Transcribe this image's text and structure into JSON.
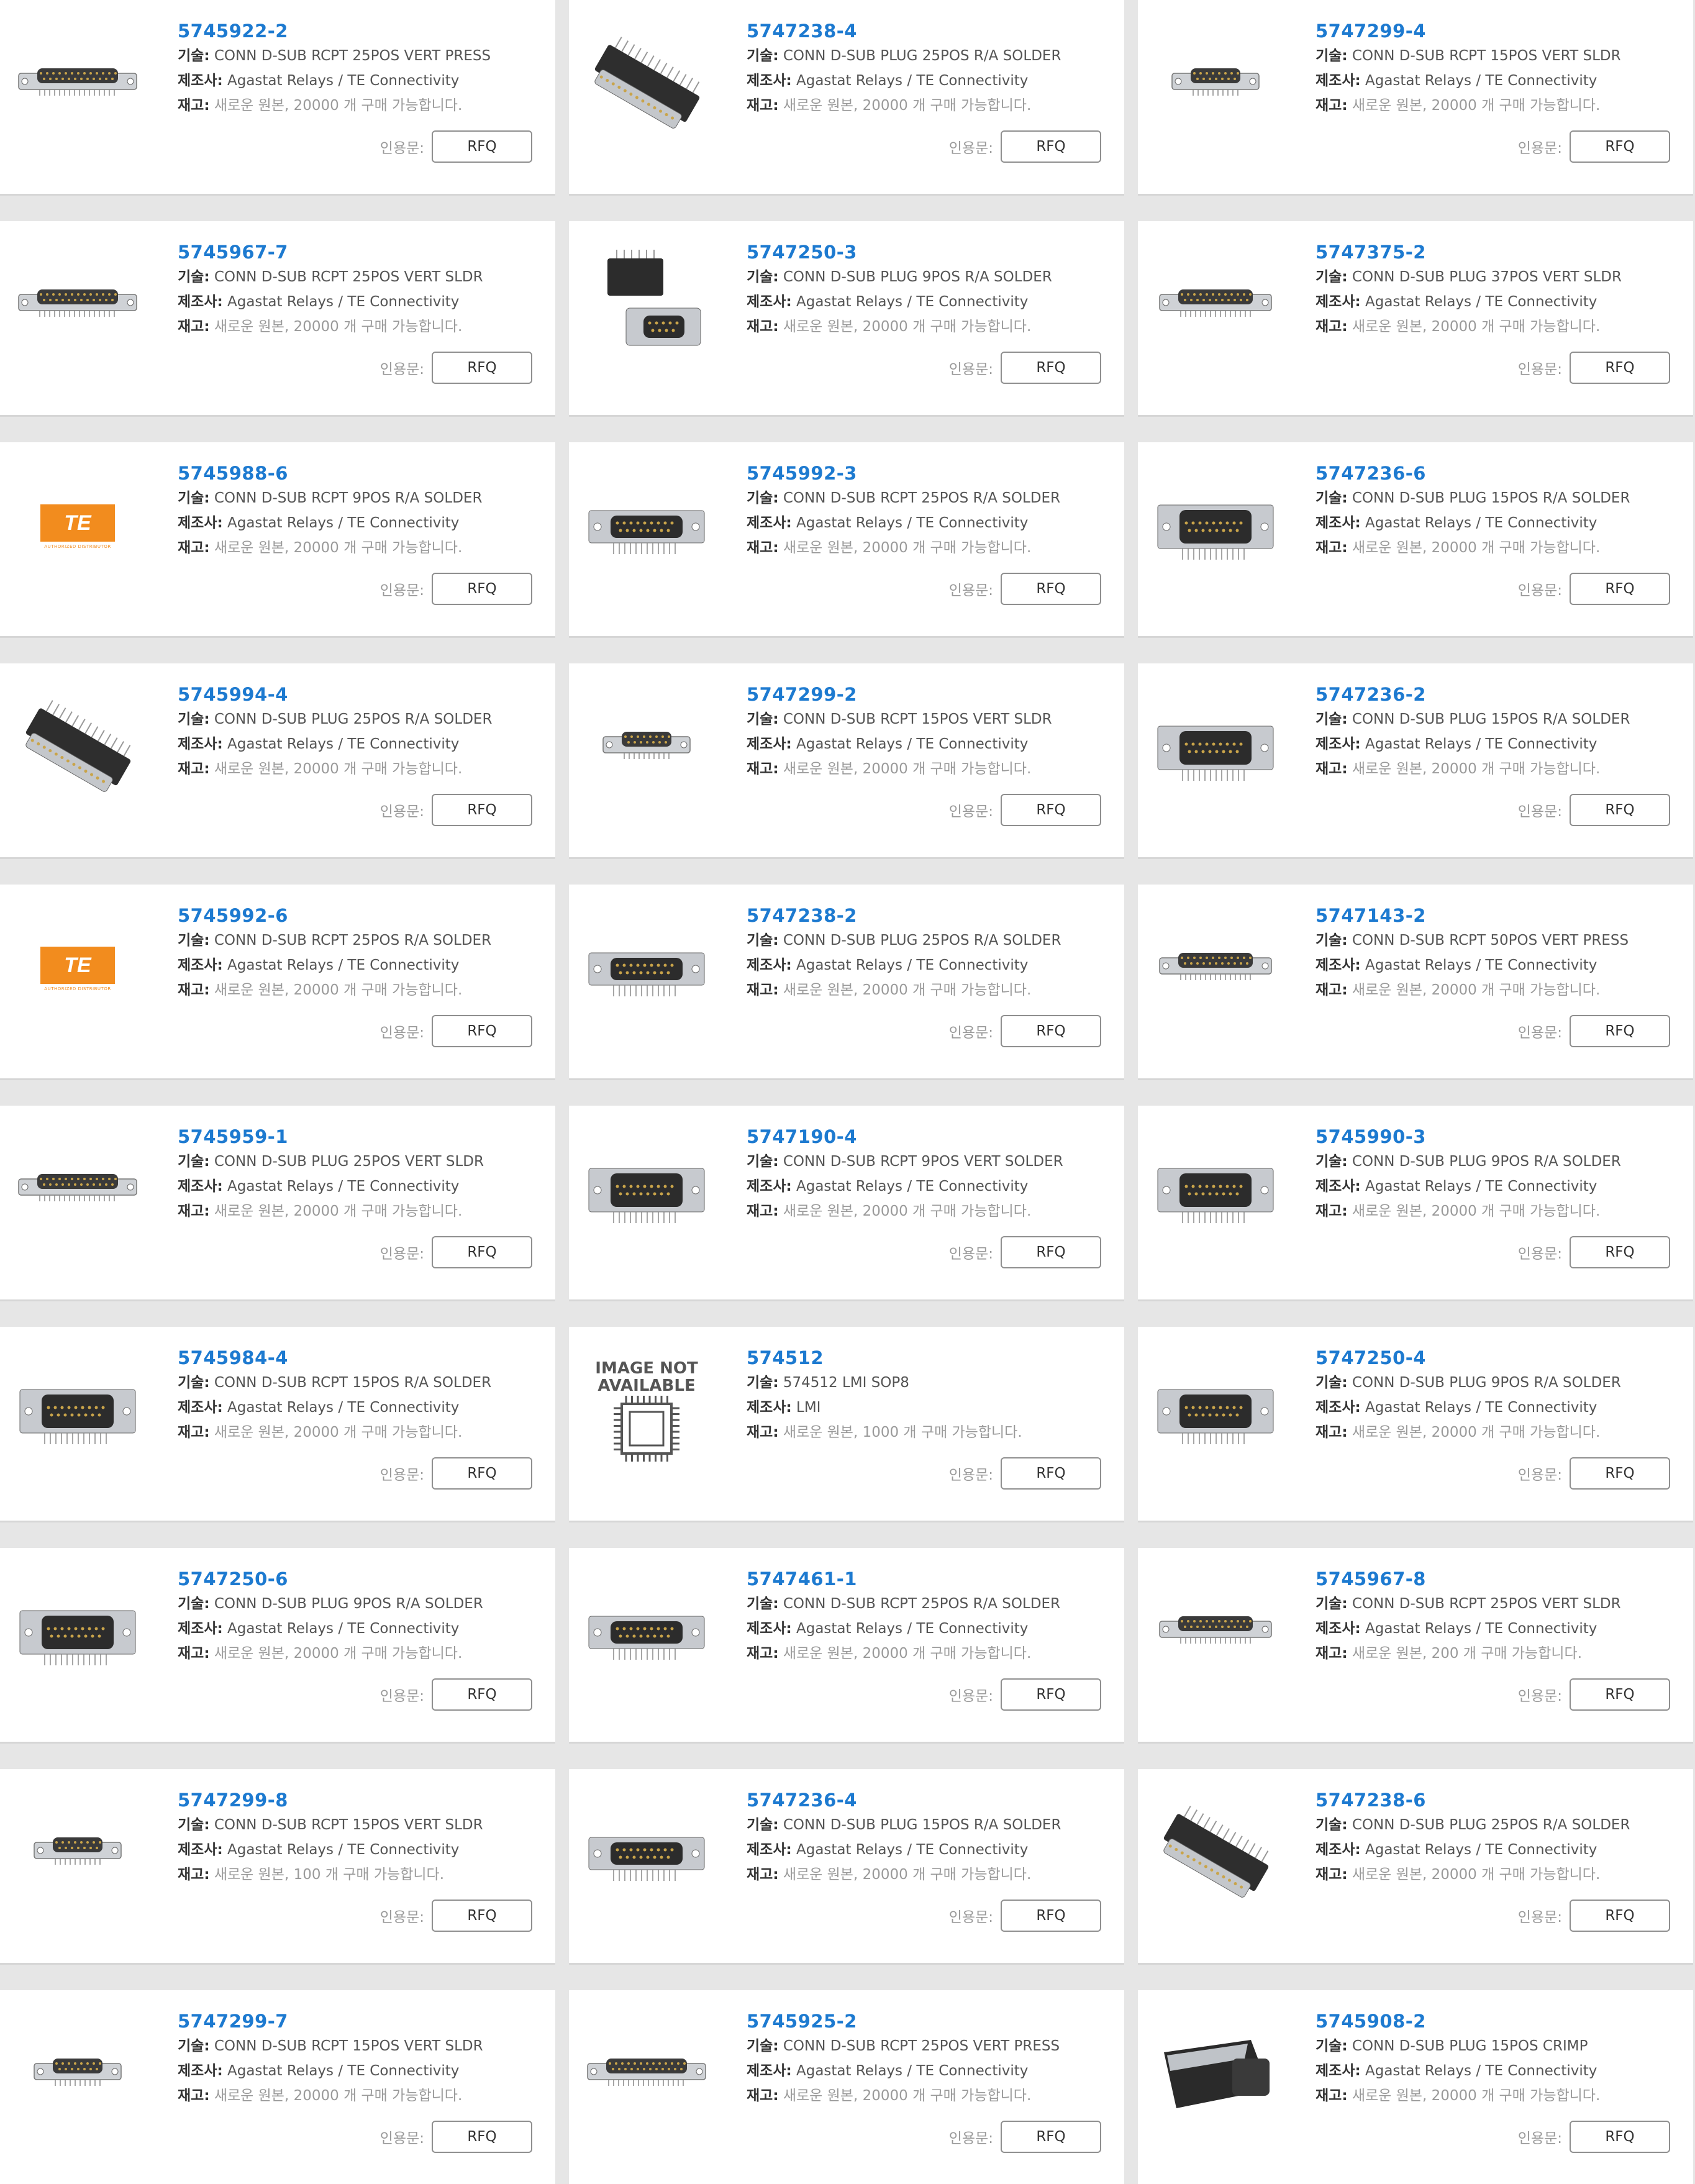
{
  "labels": {
    "desc": "기술:",
    "mfr": "제조사:",
    "stock": "재고:",
    "quote": "인용문:",
    "rfq": "RFQ"
  },
  "logo": {
    "brand": "TE",
    "tagline": "AUTHORIZED DISTRIBUTOR"
  },
  "placeholder": {
    "line1": "IMAGE NOT",
    "line2": "AVAILABLE"
  },
  "products": [
    {
      "pn": "5745922-2",
      "desc": "CONN D-SUB RCPT 25POS VERT PRESS",
      "mfr": "Agastat Relays / TE Connectivity",
      "stock": "새로운 원본, 20000 개 구매 가능합니다.",
      "img": "vert"
    },
    {
      "pn": "5747238-4",
      "desc": "CONN D-SUB PLUG 25POS R/A SOLDER",
      "mfr": "Agastat Relays / TE Connectivity",
      "stock": "새로운 원본, 20000 개 구매 가능합니다.",
      "img": "angled"
    },
    {
      "pn": "5747299-4",
      "desc": "CONN D-SUB RCPT 15POS VERT SLDR",
      "mfr": "Agastat Relays / TE Connectivity",
      "stock": "새로운 원본, 20000 개 구매 가능합니다.",
      "img": "vert-small"
    },
    {
      "pn": "5745967-7",
      "desc": "CONN D-SUB RCPT 25POS VERT SLDR",
      "mfr": "Agastat Relays / TE Connectivity",
      "stock": "새로운 원본, 20000 개 구매 가능합니다.",
      "img": "vert"
    },
    {
      "pn": "5747250-3",
      "desc": "CONN D-SUB PLUG 9POS R/A SOLDER",
      "mfr": "Agastat Relays / TE Connectivity",
      "stock": "새로운 원본, 20000 개 구매 가능합니다.",
      "img": "pair"
    },
    {
      "pn": "5747375-2",
      "desc": "CONN D-SUB PLUG 37POS VERT SLDR",
      "mfr": "Agastat Relays / TE Connectivity",
      "stock": "새로운 원본, 20000 개 구매 가능합니다.",
      "img": "vert-long"
    },
    {
      "pn": "5745988-6",
      "desc": "CONN D-SUB RCPT 9POS R/A SOLDER",
      "mfr": "Agastat Relays / TE Connectivity",
      "stock": "새로운 원본, 20000 개 구매 가능합니다.",
      "img": "logo"
    },
    {
      "pn": "5745992-3",
      "desc": "CONN D-SUB RCPT 25POS R/A SOLDER",
      "mfr": "Agastat Relays / TE Connectivity",
      "stock": "새로운 원본, 20000 개 구매 가능합니다.",
      "img": "ra"
    },
    {
      "pn": "5747236-6",
      "desc": "CONN D-SUB PLUG 15POS R/A SOLDER",
      "mfr": "Agastat Relays / TE Connectivity",
      "stock": "새로운 원본, 20000 개 구매 가능합니다.",
      "img": "ra-tall"
    },
    {
      "pn": "5745994-4",
      "desc": "CONN D-SUB PLUG 25POS R/A SOLDER",
      "mfr": "Agastat Relays / TE Connectivity",
      "stock": "새로운 원본, 20000 개 구매 가능합니다.",
      "img": "angled"
    },
    {
      "pn": "5747299-2",
      "desc": "CONN D-SUB RCPT 15POS VERT SLDR",
      "mfr": "Agastat Relays / TE Connectivity",
      "stock": "새로운 원본, 20000 개 구매 가능합니다.",
      "img": "vert-small"
    },
    {
      "pn": "5747236-2",
      "desc": "CONN D-SUB PLUG 15POS R/A SOLDER",
      "mfr": "Agastat Relays / TE Connectivity",
      "stock": "새로운 원본, 20000 개 구매 가능합니다.",
      "img": "ra-tall"
    },
    {
      "pn": "5745992-6",
      "desc": "CONN D-SUB RCPT 25POS R/A SOLDER",
      "mfr": "Agastat Relays / TE Connectivity",
      "stock": "새로운 원본, 20000 개 구매 가능합니다.",
      "img": "logo"
    },
    {
      "pn": "5747238-2",
      "desc": "CONN D-SUB PLUG 25POS R/A SOLDER",
      "mfr": "Agastat Relays / TE Connectivity",
      "stock": "새로운 원본, 20000 개 구매 가능합니다.",
      "img": "ra"
    },
    {
      "pn": "5747143-2",
      "desc": "CONN D-SUB RCPT 50POS VERT PRESS",
      "mfr": "Agastat Relays / TE Connectivity",
      "stock": "새로운 원본, 20000 개 구매 가능합니다.",
      "img": "vert-long"
    },
    {
      "pn": "5745959-1",
      "desc": "CONN D-SUB PLUG 25POS VERT SLDR",
      "mfr": "Agastat Relays / TE Connectivity",
      "stock": "새로운 원본, 20000 개 구매 가능합니다.",
      "img": "vert"
    },
    {
      "pn": "5747190-4",
      "desc": "CONN D-SUB RCPT 9POS VERT SOLDER",
      "mfr": "Agastat Relays / TE Connectivity",
      "stock": "새로운 원본, 20000 개 구매 가능합니다.",
      "img": "ra-tall"
    },
    {
      "pn": "5745990-3",
      "desc": "CONN D-SUB PLUG 9POS R/A SOLDER",
      "mfr": "Agastat Relays / TE Connectivity",
      "stock": "새로운 원본, 20000 개 구매 가능합니다.",
      "img": "ra-tall"
    },
    {
      "pn": "5745984-4",
      "desc": "CONN D-SUB RCPT 15POS R/A SOLDER",
      "mfr": "Agastat Relays / TE Connectivity",
      "stock": "새로운 원본, 20000 개 구매 가능합니다.",
      "img": "ra-tall"
    },
    {
      "pn": "574512",
      "desc": "574512 LMI SOP8",
      "mfr": "LMI",
      "stock": "새로운 원본, 1000 개 구매 가능합니다.",
      "img": "na"
    },
    {
      "pn": "5747250-4",
      "desc": "CONN D-SUB PLUG 9POS R/A SOLDER",
      "mfr": "Agastat Relays / TE Connectivity",
      "stock": "새로운 원본, 20000 개 구매 가능합니다.",
      "img": "ra-tall"
    },
    {
      "pn": "5747250-6",
      "desc": "CONN D-SUB PLUG 9POS R/A SOLDER",
      "mfr": "Agastat Relays / TE Connectivity",
      "stock": "새로운 원본, 20000 개 구매 가능합니다.",
      "img": "ra-tall"
    },
    {
      "pn": "5747461-1",
      "desc": "CONN D-SUB RCPT 25POS R/A SOLDER",
      "mfr": "Agastat Relays / TE Connectivity",
      "stock": "새로운 원본, 20000 개 구매 가능합니다.",
      "img": "ra"
    },
    {
      "pn": "5745967-8",
      "desc": "CONN D-SUB RCPT 25POS VERT SLDR",
      "mfr": "Agastat Relays / TE Connectivity",
      "stock": "새로운 원본, 200 개 구매 가능합니다.",
      "img": "vert-long"
    },
    {
      "pn": "5747299-8",
      "desc": "CONN D-SUB RCPT 15POS VERT SLDR",
      "mfr": "Agastat Relays / TE Connectivity",
      "stock": "새로운 원본, 100 개 구매 가능합니다.",
      "img": "vert-small"
    },
    {
      "pn": "5747236-4",
      "desc": "CONN D-SUB PLUG 15POS R/A SOLDER",
      "mfr": "Agastat Relays / TE Connectivity",
      "stock": "새로운 원본, 20000 개 구매 가능합니다.",
      "img": "ra"
    },
    {
      "pn": "5747238-6",
      "desc": "CONN D-SUB PLUG 25POS R/A SOLDER",
      "mfr": "Agastat Relays / TE Connectivity",
      "stock": "새로운 원본, 20000 개 구매 가능합니다.",
      "img": "angled"
    },
    {
      "pn": "5747299-7",
      "desc": "CONN D-SUB RCPT 15POS VERT SLDR",
      "mfr": "Agastat Relays / TE Connectivity",
      "stock": "새로운 원본, 20000 개 구매 가능합니다.",
      "img": "vert-small"
    },
    {
      "pn": "5745925-2",
      "desc": "CONN D-SUB RCPT 25POS VERT PRESS",
      "mfr": "Agastat Relays / TE Connectivity",
      "stock": "새로운 원본, 20000 개 구매 가능합니다.",
      "img": "vert"
    },
    {
      "pn": "5745908-2",
      "desc": "CONN D-SUB PLUG 15POS CRIMP",
      "mfr": "Agastat Relays / TE Connectivity",
      "stock": "새로운 원본, 20000 개 구매 가능합니다.",
      "img": "crimp"
    }
  ]
}
